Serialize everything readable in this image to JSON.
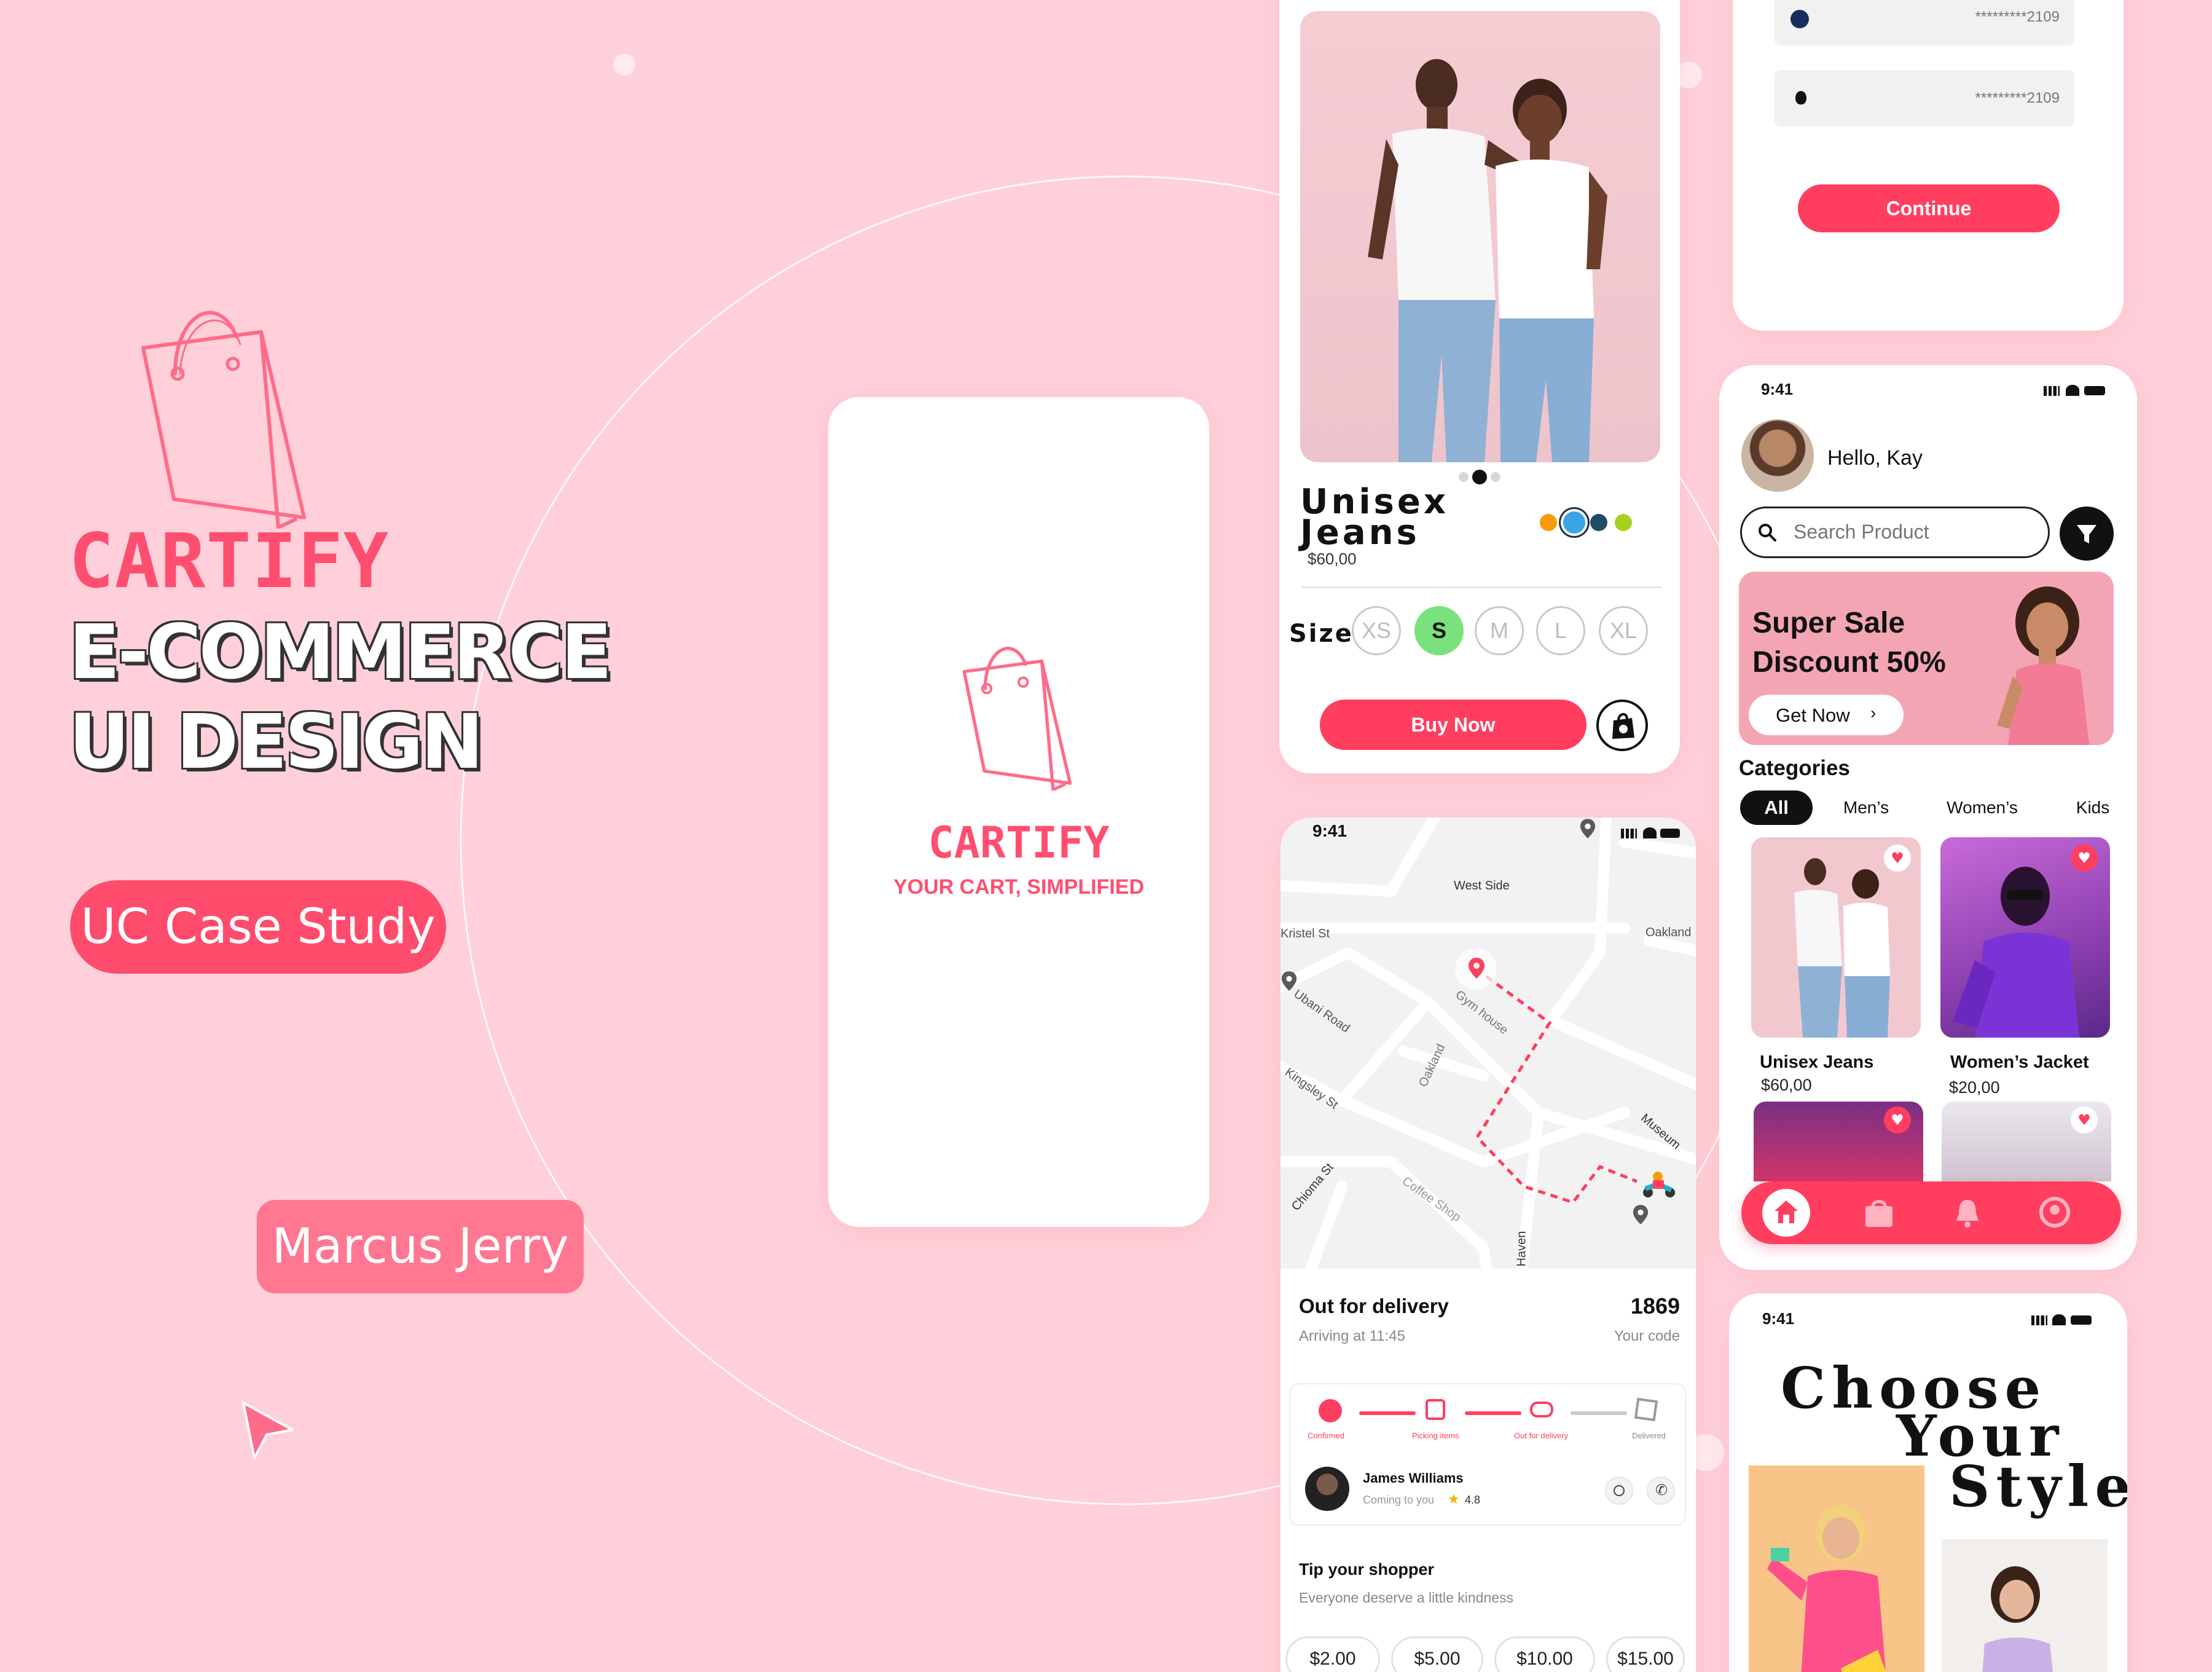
{
  "hero": {
    "brand": "CARTIFY",
    "title_line1": "E-COMMERCE",
    "title_line2": "UI DESIGN",
    "case_study_label": "UC Case Study",
    "author_label": "Marcus Jerry"
  },
  "splash": {
    "brand": "CARTIFY",
    "tagline": "YOUR CART, SIMPLIFIED"
  },
  "product_detail": {
    "title_line1": "Unisex",
    "title_line2": "Jeans",
    "price": "$60,00",
    "size_label": "Size",
    "sizes": [
      "XS",
      "S",
      "M",
      "L",
      "XL"
    ],
    "selected_size": "S",
    "colors": [
      "#f59b0b",
      "#3ba3e6",
      "#1f4d66",
      "#a6d21f"
    ],
    "buy_label": "Buy Now"
  },
  "payment": {
    "card1_masked": "*********2109",
    "card2_masked": "*********2109",
    "continue_label": "Continue"
  },
  "tracking": {
    "status_time": "9:41",
    "map_labels": {
      "west_side": "West Side",
      "kristel": "Kristel St",
      "oakland_top": "Oakland",
      "ubani": "Ubani Road",
      "gym": "Gym house",
      "oakland_mid": "Oakland",
      "kingsley": "Kingsley St",
      "museum": "Museum",
      "chioma": "Chioma St",
      "coffee": "Coffee Shop",
      "haven": "Haven"
    },
    "status_title": "Out for delivery",
    "code": "1869",
    "arriving": "Arriving at 11:45",
    "code_label": "Your code",
    "steps": [
      "Confirmed",
      "Picking items",
      "Out for delivery",
      "Delivered"
    ],
    "driver_name": "James Williams",
    "driver_sub": "Coming to you",
    "driver_rating": "4.8",
    "tip_title": "Tip your shopper",
    "tip_sub": "Everyone deserve a little kindness",
    "tips": [
      "$2.00",
      "$5.00",
      "$10.00",
      "$15.00"
    ]
  },
  "home": {
    "status_time": "9:41",
    "greeting": "Hello, Kay",
    "search_placeholder": "Search Product",
    "banner_line1": "Super Sale",
    "banner_line2": "Discount 50%",
    "banner_cta": "Get Now",
    "categories_title": "Categories",
    "categories": [
      "All",
      "Men’s",
      "Women’s",
      "Kids"
    ],
    "products": [
      {
        "name": "Unisex Jeans",
        "price": "$60,00"
      },
      {
        "name": "Women’s Jacket",
        "price": "$20,00"
      }
    ]
  },
  "style": {
    "status_time": "9:41",
    "line1": "Choose",
    "line2": "Your",
    "line3": "Style"
  },
  "colors": {
    "background": "#ffd0d9",
    "accent": "#ff3e60",
    "brand_pink": "#ff4f70"
  }
}
